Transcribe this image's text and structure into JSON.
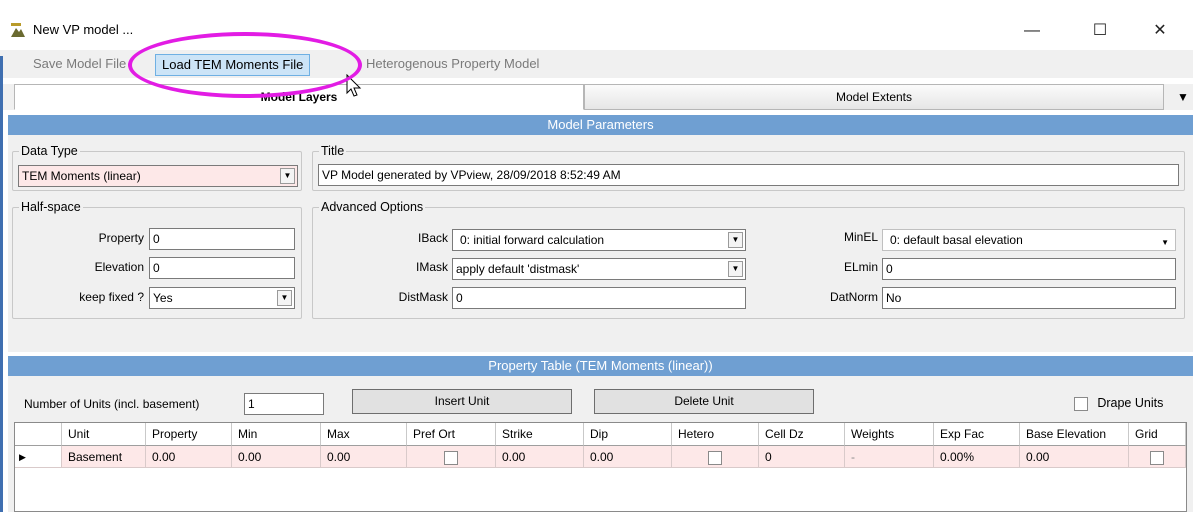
{
  "window": {
    "title": "New VP model ...",
    "controls": {
      "minimize": "—",
      "maximize": "☐",
      "close": "✕"
    }
  },
  "menu": {
    "items": [
      "Save Model File",
      "Load TEM Moments File",
      "Heterogenous Property Model"
    ],
    "active_index": 1
  },
  "tabs": {
    "items": [
      "Model Layers",
      "Model Extents"
    ],
    "selected_index": 0,
    "overflow_arrow": "▼"
  },
  "model_parameters": {
    "header": "Model Parameters",
    "data_type": {
      "legend": "Data Type",
      "value": "TEM Moments (linear)"
    },
    "title_group": {
      "legend": "Title",
      "value": "VP Model generated by VPview, 28/09/2018 8:52:49 AM"
    },
    "half_space": {
      "legend": "Half-space",
      "property_label": "Property",
      "property_value": "0",
      "elevation_label": "Elevation",
      "elevation_value": "0",
      "keep_fixed_label": "keep fixed ?",
      "keep_fixed_value": "Yes"
    },
    "advanced": {
      "legend": "Advanced Options",
      "iback_label": "IBack",
      "iback_value": "0: initial forward calculation",
      "imask_label": "IMask",
      "imask_value": "apply default 'distmask'",
      "distmask_label": "DistMask",
      "distmask_value": "0",
      "minel_label": "MinEL",
      "minel_value": "0: default basal elevation",
      "elmin_label": "ELmin",
      "elmin_value": "0",
      "datnorm_label": "DatNorm",
      "datnorm_value": "No"
    }
  },
  "property_table": {
    "header": "Property Table (TEM Moments (linear))",
    "num_units_label": "Number of Units (incl. basement)",
    "num_units_value": "1",
    "insert_unit": "Insert Unit",
    "delete_unit": "Delete Unit",
    "drape_units": "Drape Units",
    "drape_checked": false,
    "columns": [
      "Unit",
      "Property",
      "Min",
      "Max",
      "Pref Ort",
      "Strike",
      "Dip",
      "Hetero",
      "Cell Dz",
      "Weights",
      "Exp Fac",
      "Base Elevation",
      "Grid"
    ],
    "rows": [
      {
        "unit": "Basement",
        "property": "0.00",
        "min": "0.00",
        "max": "0.00",
        "pref_ort": false,
        "strike": "0.00",
        "dip": "0.00",
        "hetero": false,
        "cell_dz": "0",
        "weights": "-",
        "exp_fac": "0.00%",
        "base_elevation": "0.00",
        "grid": false
      }
    ],
    "row_indicator": "▶"
  },
  "colors": {
    "section_header": "#6f9fd2",
    "highlight_ring": "#e21ce4",
    "row_pink": "#fde8e8"
  }
}
